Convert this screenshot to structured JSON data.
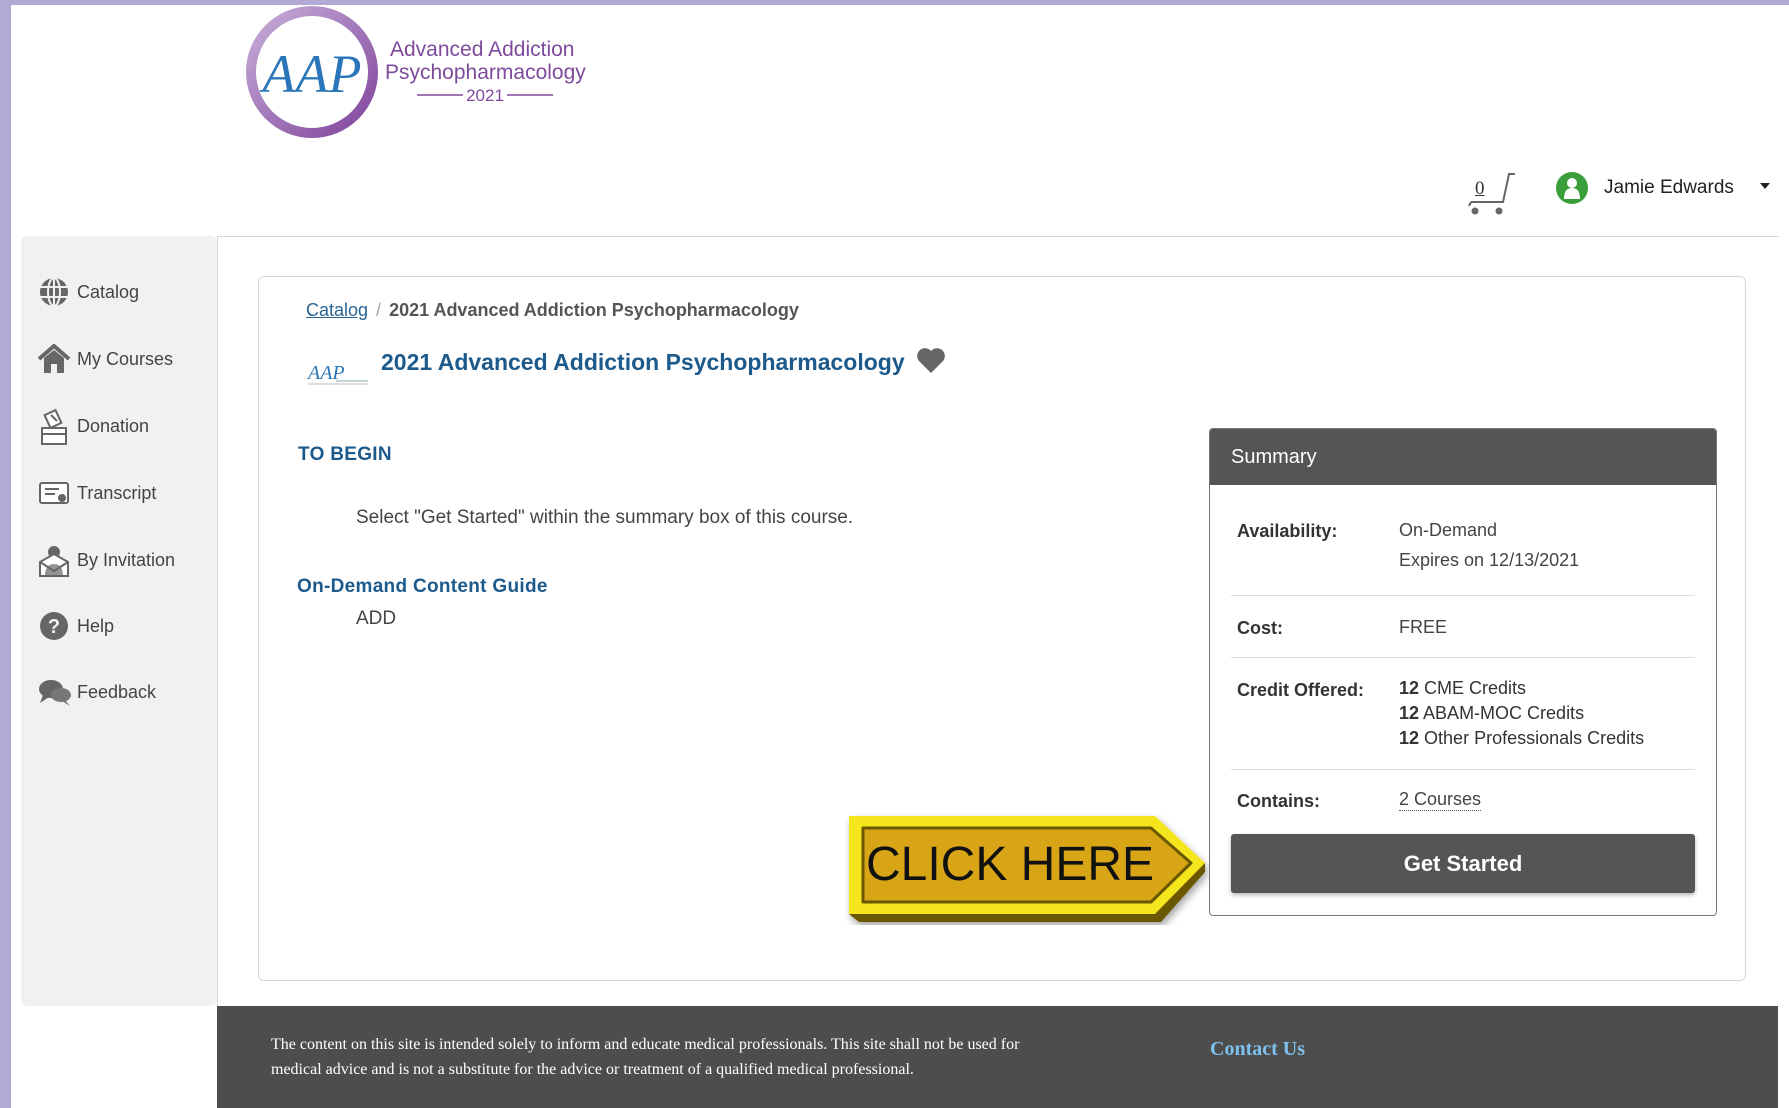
{
  "brand": {
    "logo_mark": "AAP",
    "line1": "Advanced Addiction",
    "line2": "Psychopharmacology",
    "year": "2021"
  },
  "header": {
    "cart_count": "0",
    "user_name": "Jamie Edwards"
  },
  "sidebar": {
    "items": [
      {
        "label": "Catalog",
        "icon": "globe-icon"
      },
      {
        "label": "My Courses",
        "icon": "home-icon"
      },
      {
        "label": "Donation",
        "icon": "donation-icon"
      },
      {
        "label": "Transcript",
        "icon": "transcript-icon"
      },
      {
        "label": "By Invitation",
        "icon": "invitation-icon"
      },
      {
        "label": "Help",
        "icon": "help-icon"
      },
      {
        "label": "Feedback",
        "icon": "feedback-icon"
      }
    ]
  },
  "breadcrumb": {
    "root": "Catalog",
    "separator": "/",
    "current": "2021 Advanced Addiction Psychopharmacology"
  },
  "course": {
    "title": "2021 Advanced Addiction Psychopharmacology",
    "to_begin_heading": "TO BEGIN",
    "to_begin_text": "Select \"Get Started\" within the summary box of this course.",
    "guide_heading": "On-Demand Content Guide",
    "guide_text": "ADD"
  },
  "summary": {
    "title": "Summary",
    "availability_label": "Availability:",
    "availability_value": "On-Demand",
    "availability_expiry": "Expires on 12/13/2021",
    "cost_label": "Cost:",
    "cost_value": "FREE",
    "credit_label": "Credit Offered:",
    "credits": [
      {
        "count": "12",
        "name": "CME Credits"
      },
      {
        "count": "12",
        "name": "ABAM-MOC Credits"
      },
      {
        "count": "12",
        "name": "Other Professionals Credits"
      }
    ],
    "contains_label": "Contains:",
    "contains_value": "2 Courses",
    "button_label": "Get Started"
  },
  "callout": {
    "text": "CLICK HERE"
  },
  "footer": {
    "disclaimer_line1": "The content on this site is intended solely to inform and educate medical professionals. This site shall not be used for",
    "disclaimer_line2": "medical advice and is not a substitute for the advice or treatment of a qualified medical professional.",
    "contact_label": "Contact Us"
  },
  "colors": {
    "page_border": "#b3a9d6",
    "title_blue": "#1d5a8c",
    "summary_header": "#555555",
    "footer_bg": "#4d4d4d",
    "contact_link": "#7ec0ee",
    "callout_yellow": "#f5e51e",
    "user_green": "#3a9e3a"
  }
}
